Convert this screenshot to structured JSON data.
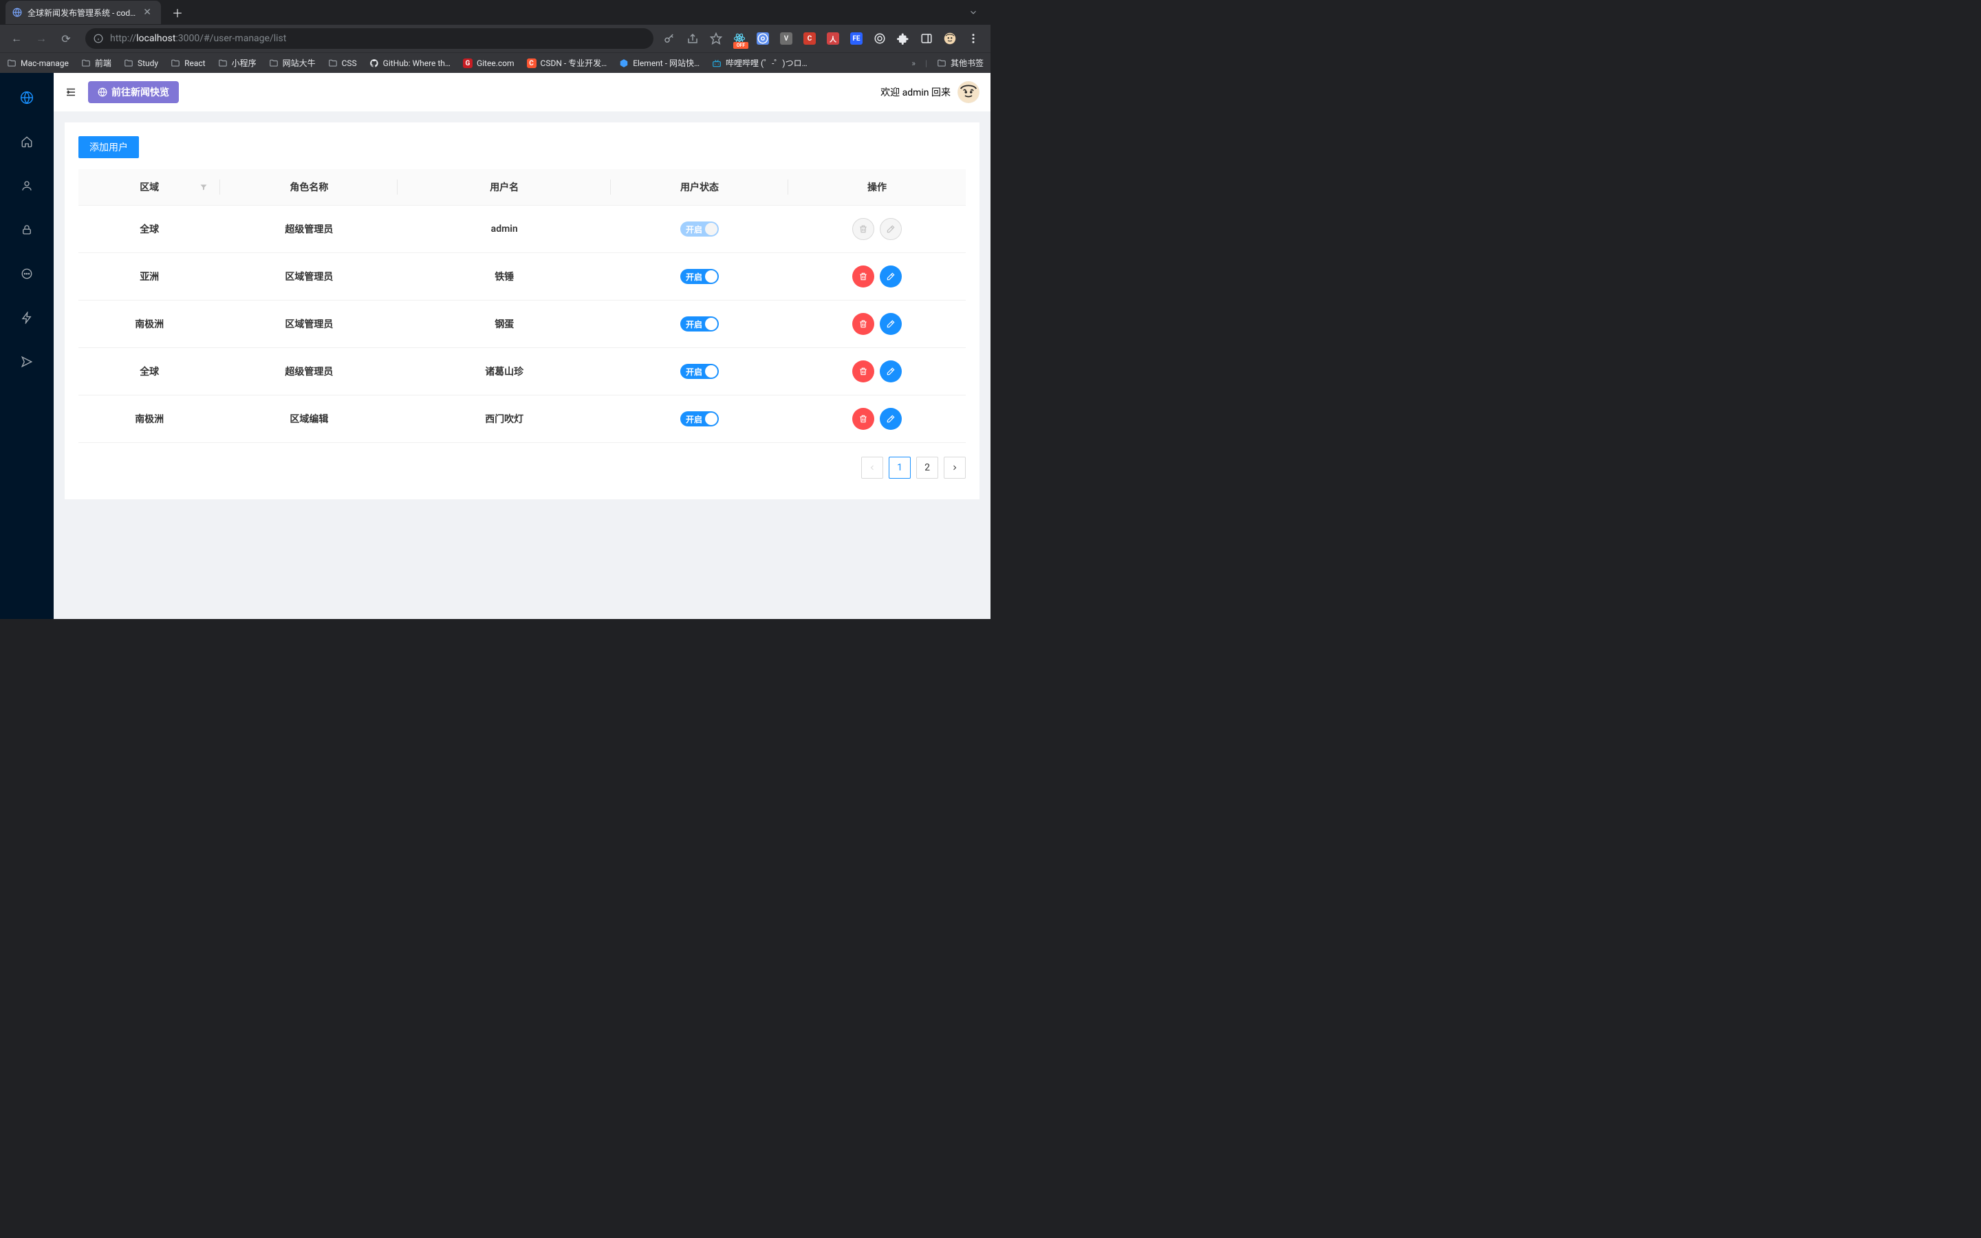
{
  "browser": {
    "tab_title": "全球新闻发布管理系统 - codeM",
    "url_scheme": "http://",
    "url_host": "localhost",
    "url_port_path": ":3000/#/user-manage/list",
    "bookmarks": [
      "Mac-manage",
      "前端",
      "Study",
      "React",
      "小程序",
      "网站大牛",
      "CSS",
      "GitHub: Where th…",
      "Gitee.com",
      "CSDN - 专业开发…",
      "Element - 网站快…",
      "哔哩哔哩 (゜-゜)つロ…"
    ],
    "other_bookmarks_label": "其他书签",
    "ext_react_badge": "OFF"
  },
  "header": {
    "news_preview_btn_label": "前往新闻快览",
    "welcome_prefix": "欢迎 ",
    "welcome_user": "admin",
    "welcome_suffix": " 回来"
  },
  "content": {
    "add_user_btn": "添加用户",
    "columns": {
      "region": "区域",
      "role": "角色名称",
      "username": "用户名",
      "status": "用户状态",
      "actions": "操作"
    },
    "switch_on_label": "开启",
    "rows": [
      {
        "region": "全球",
        "role": "超级管理员",
        "username": "admin",
        "status_on": true,
        "actions_disabled": true
      },
      {
        "region": "亚洲",
        "role": "区域管理员",
        "username": "铁锤",
        "status_on": true,
        "actions_disabled": false
      },
      {
        "region": "南极洲",
        "role": "区域管理员",
        "username": "钢蛋",
        "status_on": true,
        "actions_disabled": false
      },
      {
        "region": "全球",
        "role": "超级管理员",
        "username": "诸葛山珍",
        "status_on": true,
        "actions_disabled": false
      },
      {
        "region": "南极洲",
        "role": "区域编辑",
        "username": "西门吹灯",
        "status_on": true,
        "actions_disabled": false
      }
    ],
    "pagination": {
      "current": 1,
      "pages": [
        1,
        2
      ]
    }
  }
}
